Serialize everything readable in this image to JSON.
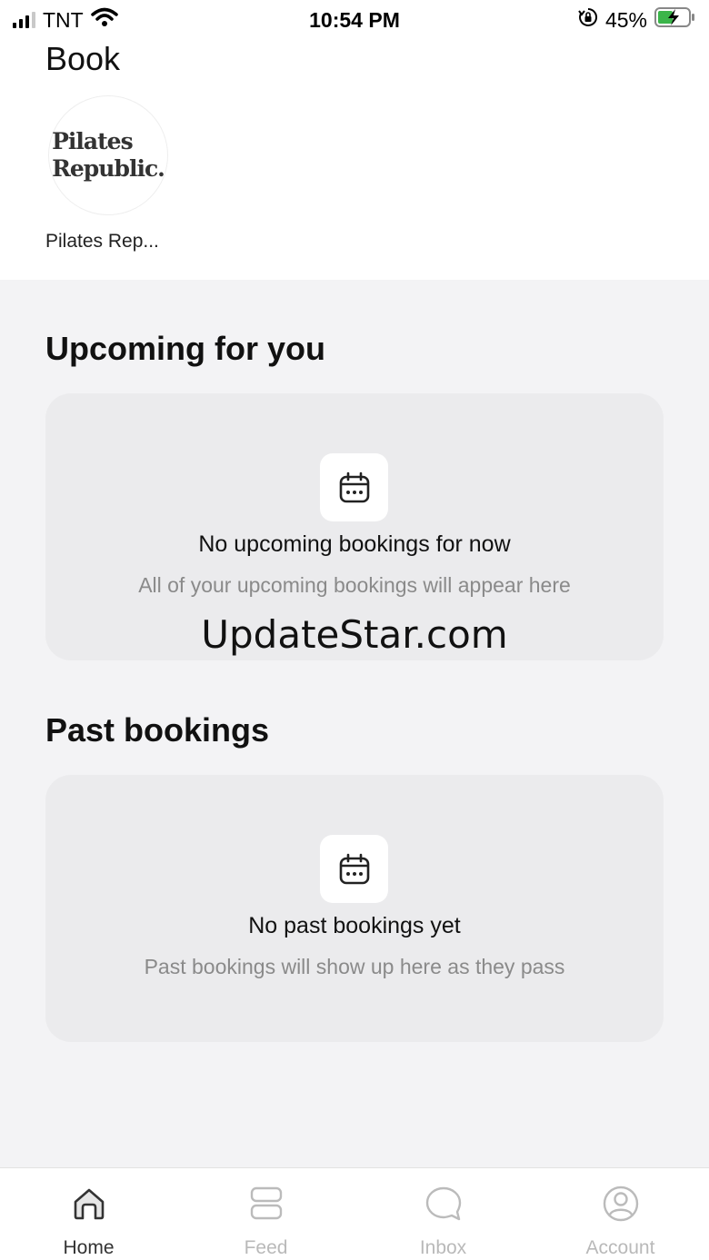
{
  "status_bar": {
    "carrier": "TNT",
    "time": "10:54 PM",
    "battery": "45%"
  },
  "header": {
    "title": "Book"
  },
  "studio": {
    "logo_text_line1": "Pilates",
    "logo_text_line2": "Republic.",
    "name": "Pilates Rep..."
  },
  "upcoming": {
    "section_title": "Upcoming for you",
    "empty_heading": "No upcoming bookings for now",
    "empty_subtext": "All of your upcoming bookings will appear here",
    "icon": "calendar-icon"
  },
  "past": {
    "section_title": "Past bookings",
    "empty_heading": "No past bookings yet",
    "empty_subtext": "Past bookings will show up here as they pass",
    "icon": "calendar-icon"
  },
  "watermark": "UpdateStar.com",
  "tab_bar": {
    "tabs": [
      {
        "label": "Home",
        "icon": "home-icon",
        "active": true
      },
      {
        "label": "Feed",
        "icon": "feed-icon",
        "active": false
      },
      {
        "label": "Inbox",
        "icon": "chat-bubble-icon",
        "active": false
      },
      {
        "label": "Account",
        "icon": "user-icon",
        "active": false
      }
    ]
  },
  "colors": {
    "background_grey": "#f3f3f5",
    "card_grey": "#ebebed",
    "battery_green": "#3bb54a",
    "inactive_tab": "#b9b9b9"
  }
}
